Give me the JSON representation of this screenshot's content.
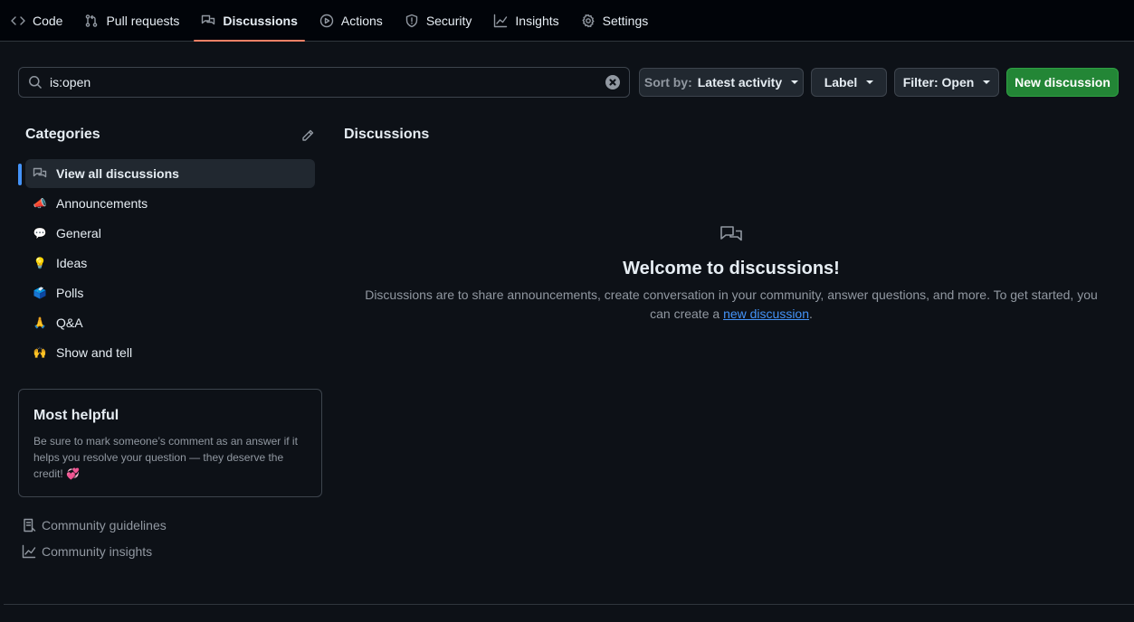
{
  "nav": {
    "tabs": [
      {
        "label": "Code",
        "icon": "code-icon"
      },
      {
        "label": "Pull requests",
        "icon": "pull-request-icon"
      },
      {
        "label": "Discussions",
        "icon": "discussions-icon"
      },
      {
        "label": "Actions",
        "icon": "play-icon"
      },
      {
        "label": "Security",
        "icon": "shield-icon"
      },
      {
        "label": "Insights",
        "icon": "graph-icon"
      },
      {
        "label": "Settings",
        "icon": "gear-icon"
      }
    ],
    "active_tab": "Discussions"
  },
  "toolbar": {
    "search_value": "is:open",
    "sort_prefix": "Sort by:",
    "sort_value": "Latest activity",
    "label_button": "Label",
    "filter_button": "Filter: Open",
    "new_button": "New discussion"
  },
  "sidebar": {
    "heading": "Categories",
    "items": [
      {
        "label": "View all discussions",
        "icon": "discussions-icon"
      },
      {
        "label": "Announcements",
        "emoji": "📣"
      },
      {
        "label": "General",
        "emoji": "💬"
      },
      {
        "label": "Ideas",
        "emoji": "💡"
      },
      {
        "label": "Polls",
        "emoji": "🗳️"
      },
      {
        "label": "Q&A",
        "emoji": "🙏"
      },
      {
        "label": "Show and tell",
        "emoji": "🙌"
      }
    ],
    "helpful": {
      "title": "Most helpful",
      "text": "Be sure to mark someone’s comment as an answer if it helps you resolve your question — they deserve the credit!",
      "emoji": "💞"
    },
    "links": {
      "guidelines": "Community guidelines",
      "insights": "Community insights"
    }
  },
  "main": {
    "heading": "Discussions",
    "welcome_title": "Welcome to discussions!",
    "welcome_text": "Discussions are to share announcements, create conversation in your community, answer questions, and more. To get started, you can create a",
    "welcome_link": "new discussion",
    "welcome_end": "."
  },
  "colors": {
    "background": "#0d1117",
    "accent_tab": "#f78166",
    "primary_button": "#238636",
    "link": "#4493f8"
  }
}
